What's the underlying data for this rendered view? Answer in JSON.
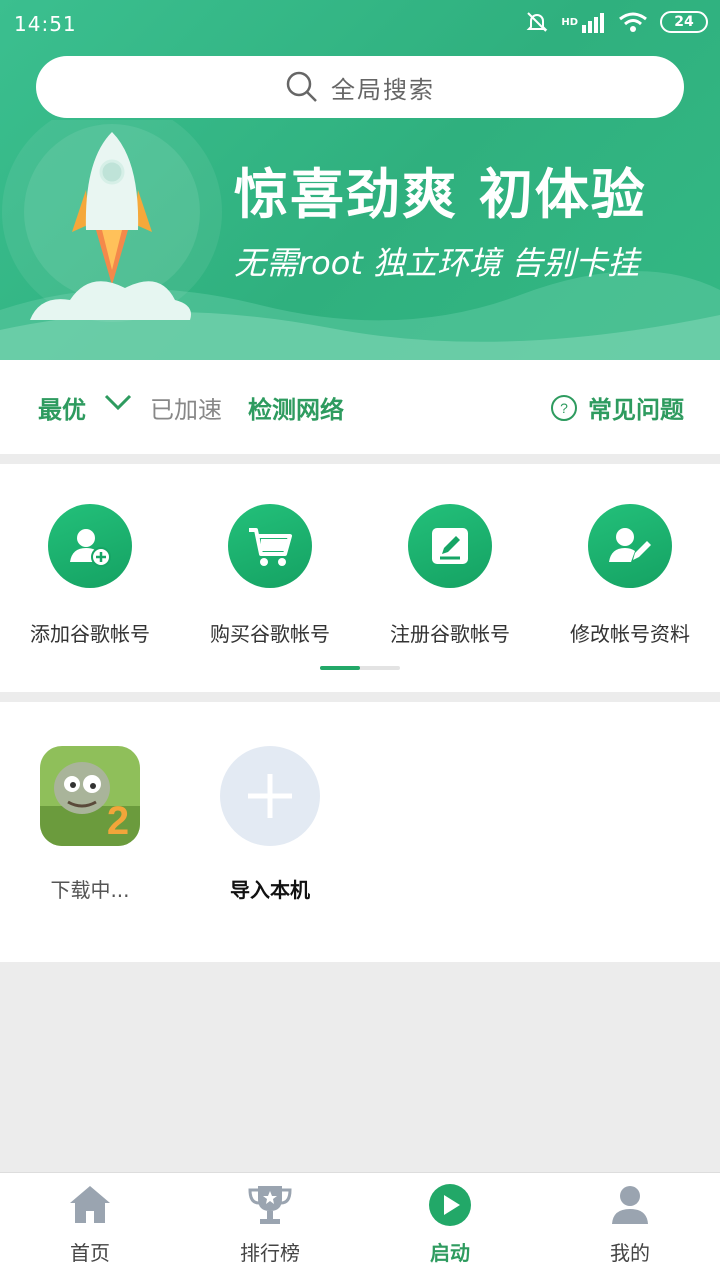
{
  "status_bar": {
    "time": "14:51",
    "battery": "24",
    "network_badge": "HD"
  },
  "search": {
    "placeholder": "全局搜索"
  },
  "banner": {
    "title": "惊喜劲爽  初体验",
    "subtitle": "无需root  独立环境  告别卡挂"
  },
  "network": {
    "mode": "最优",
    "state": "已加速",
    "check_label": "检测网络",
    "faq_label": "常见问题"
  },
  "quick_actions": [
    {
      "label": "添加谷歌帐号",
      "icon": "add-account-icon"
    },
    {
      "label": "购买谷歌帐号",
      "icon": "shopping-cart-icon"
    },
    {
      "label": "注册谷歌帐号",
      "icon": "register-edit-icon"
    },
    {
      "label": "修改帐号资料",
      "icon": "edit-profile-icon"
    }
  ],
  "pager": {
    "current_page": 1,
    "total_pages": 2
  },
  "apps": [
    {
      "label": "下载中...",
      "icon": "game-zombie-icon"
    },
    {
      "label": "导入本机",
      "icon": "plus-icon"
    }
  ],
  "bottom_nav": [
    {
      "label": "首页",
      "icon": "home-icon",
      "active": false
    },
    {
      "label": "排行榜",
      "icon": "trophy-icon",
      "active": false
    },
    {
      "label": "启动",
      "icon": "play-icon",
      "active": true
    },
    {
      "label": "我的",
      "icon": "user-icon",
      "active": false
    }
  ],
  "colors": {
    "brand_green": "#2e9b5f",
    "header_green": "#34b884",
    "inactive_gray": "#9aa4b0"
  }
}
